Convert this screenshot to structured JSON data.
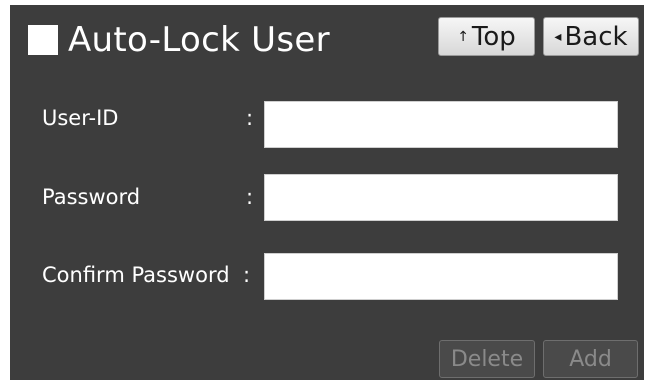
{
  "header": {
    "title": "Auto-Lock User",
    "top_button": {
      "icon": "arrow-up-icon",
      "glyph": "↑",
      "label": "Top"
    },
    "back_button": {
      "icon": "triangle-left-icon",
      "glyph": "◂",
      "label": "Back"
    }
  },
  "form": {
    "colon": ":",
    "fields": [
      {
        "label": "User-ID",
        "value": ""
      },
      {
        "label": "Password",
        "value": ""
      },
      {
        "label": "Confirm Password",
        "value": ""
      }
    ]
  },
  "actions": {
    "delete_label": "Delete",
    "add_label": "Add"
  },
  "colors": {
    "panel_background": "#3d3d3d",
    "text": "#ffffff",
    "disabled_text": "#8a8a8a"
  }
}
